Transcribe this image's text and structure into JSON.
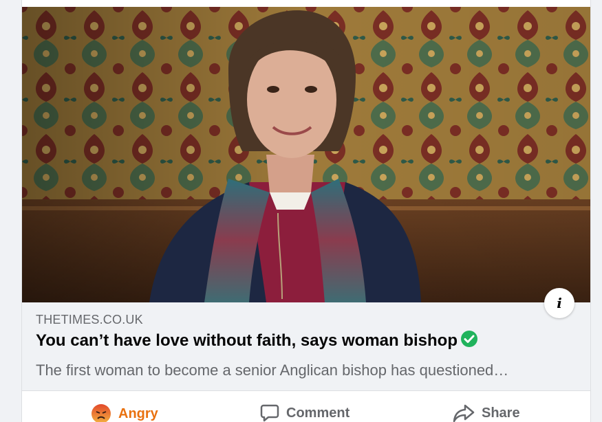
{
  "post": {
    "image_alt": "Woman bishop in clerical collar in front of patterned wallpaper",
    "info_icon": "i",
    "link": {
      "domain": "THETIMES.CO.UK",
      "title": "You can’t have love without faith, says woman bishop",
      "description": "The first woman to become a senior Anglican bishop has questioned…"
    }
  },
  "actions": {
    "reaction_label": "Angry",
    "comment_label": "Comment",
    "share_label": "Share"
  },
  "colors": {
    "angry": "#e9710f",
    "verified": "#20b35c",
    "muted_text": "#65676b"
  },
  "icons": [
    "info-icon",
    "verified-check-icon",
    "angry-face-icon",
    "comment-icon",
    "share-icon"
  ]
}
